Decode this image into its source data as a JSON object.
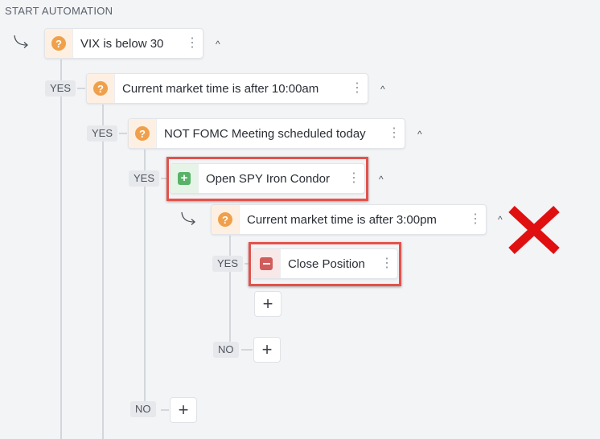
{
  "header": {
    "title": "START AUTOMATION"
  },
  "nodes": {
    "vix": {
      "label": "VIX is below 30"
    },
    "time10": {
      "label": "Current market time is after 10:00am"
    },
    "fomc": {
      "label": "NOT FOMC Meeting scheduled today"
    },
    "open_condor": {
      "label": "Open SPY Iron Condor"
    },
    "time3": {
      "label": "Current market time is after 3:00pm"
    },
    "close_pos": {
      "label": "Close Position"
    }
  },
  "branches": {
    "yes": "YES",
    "no": "NO"
  },
  "icons": {
    "condition": "question-icon",
    "open": "plus-square-icon",
    "close": "minus-square-icon",
    "menu": "kebab-menu-icon",
    "collapse": "chevron-up-icon",
    "add": "plus-icon",
    "annotation": "red-x-icon"
  },
  "glyphs": {
    "question": "?",
    "plus": "+",
    "kebab": "⋮",
    "chevron": "^",
    "add": "+"
  },
  "colors": {
    "condition": "#f0a04b",
    "open": "#58b368",
    "close": "#d05c5c",
    "highlight": "#e2534c",
    "x_mark": "#e01010"
  }
}
